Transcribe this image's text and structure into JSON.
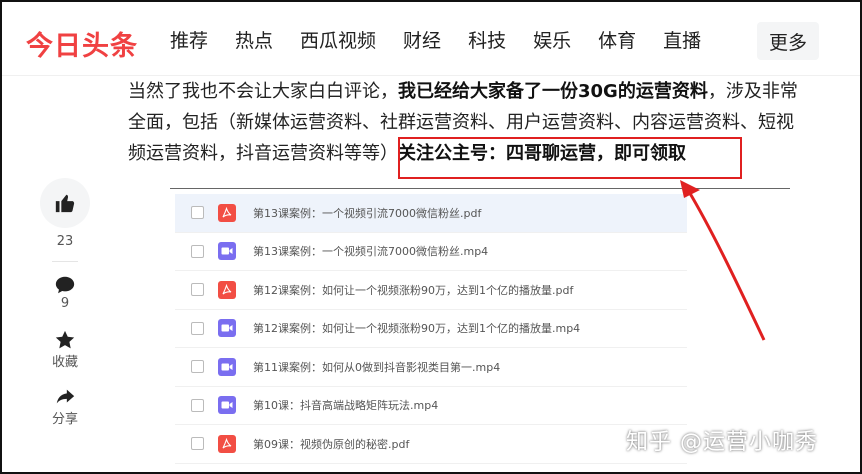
{
  "header": {
    "logo": "今日头条",
    "nav": [
      "推荐",
      "热点",
      "西瓜视频",
      "财经",
      "科技",
      "娱乐",
      "体育",
      "直播"
    ],
    "more": "更多"
  },
  "article": {
    "line1_plain": "当然了我也不会让大家白白评论，",
    "line1_bold": "我已经给大家备了一份30G的运营资料",
    "line1_tail": "，涉及非常",
    "line2": "全面，包括（新媒体运营资料、社群运营资料、用户运营资料、内容运营资料、短视",
    "line3_plain": "频运营资料，抖音运营资料等等）",
    "line3_bold": "关注公主号：四哥聊运营，即可领取"
  },
  "side": {
    "like_count": "23",
    "comment_count": "9",
    "favorite_label": "收藏",
    "share_label": "分享"
  },
  "files": [
    {
      "name": "第13课案例：一个视频引流7000微信粉丝.pdf",
      "type": "pdf"
    },
    {
      "name": "第13课案例：一个视频引流7000微信粉丝.mp4",
      "type": "mp4"
    },
    {
      "name": "第12课案例：如何让一个视频涨粉90万，达到1个亿的播放量.pdf",
      "type": "pdf"
    },
    {
      "name": "第12课案例：如何让一个视频涨粉90万，达到1个亿的播放量.mp4",
      "type": "mp4"
    },
    {
      "name": "第11课案例：如何从0做到抖音影视类目第一.mp4",
      "type": "mp4"
    },
    {
      "name": "第10课：抖音高端战略矩阵玩法.mp4",
      "type": "mp4"
    },
    {
      "name": "第09课：视频伪原创的秘密.pdf",
      "type": "pdf"
    }
  ],
  "watermark": "知乎 @运营小咖秀",
  "colors": {
    "brand": "#f04142",
    "pdf": "#f24e44",
    "mp4": "#7a6ef0",
    "highlight": "#e02020"
  }
}
